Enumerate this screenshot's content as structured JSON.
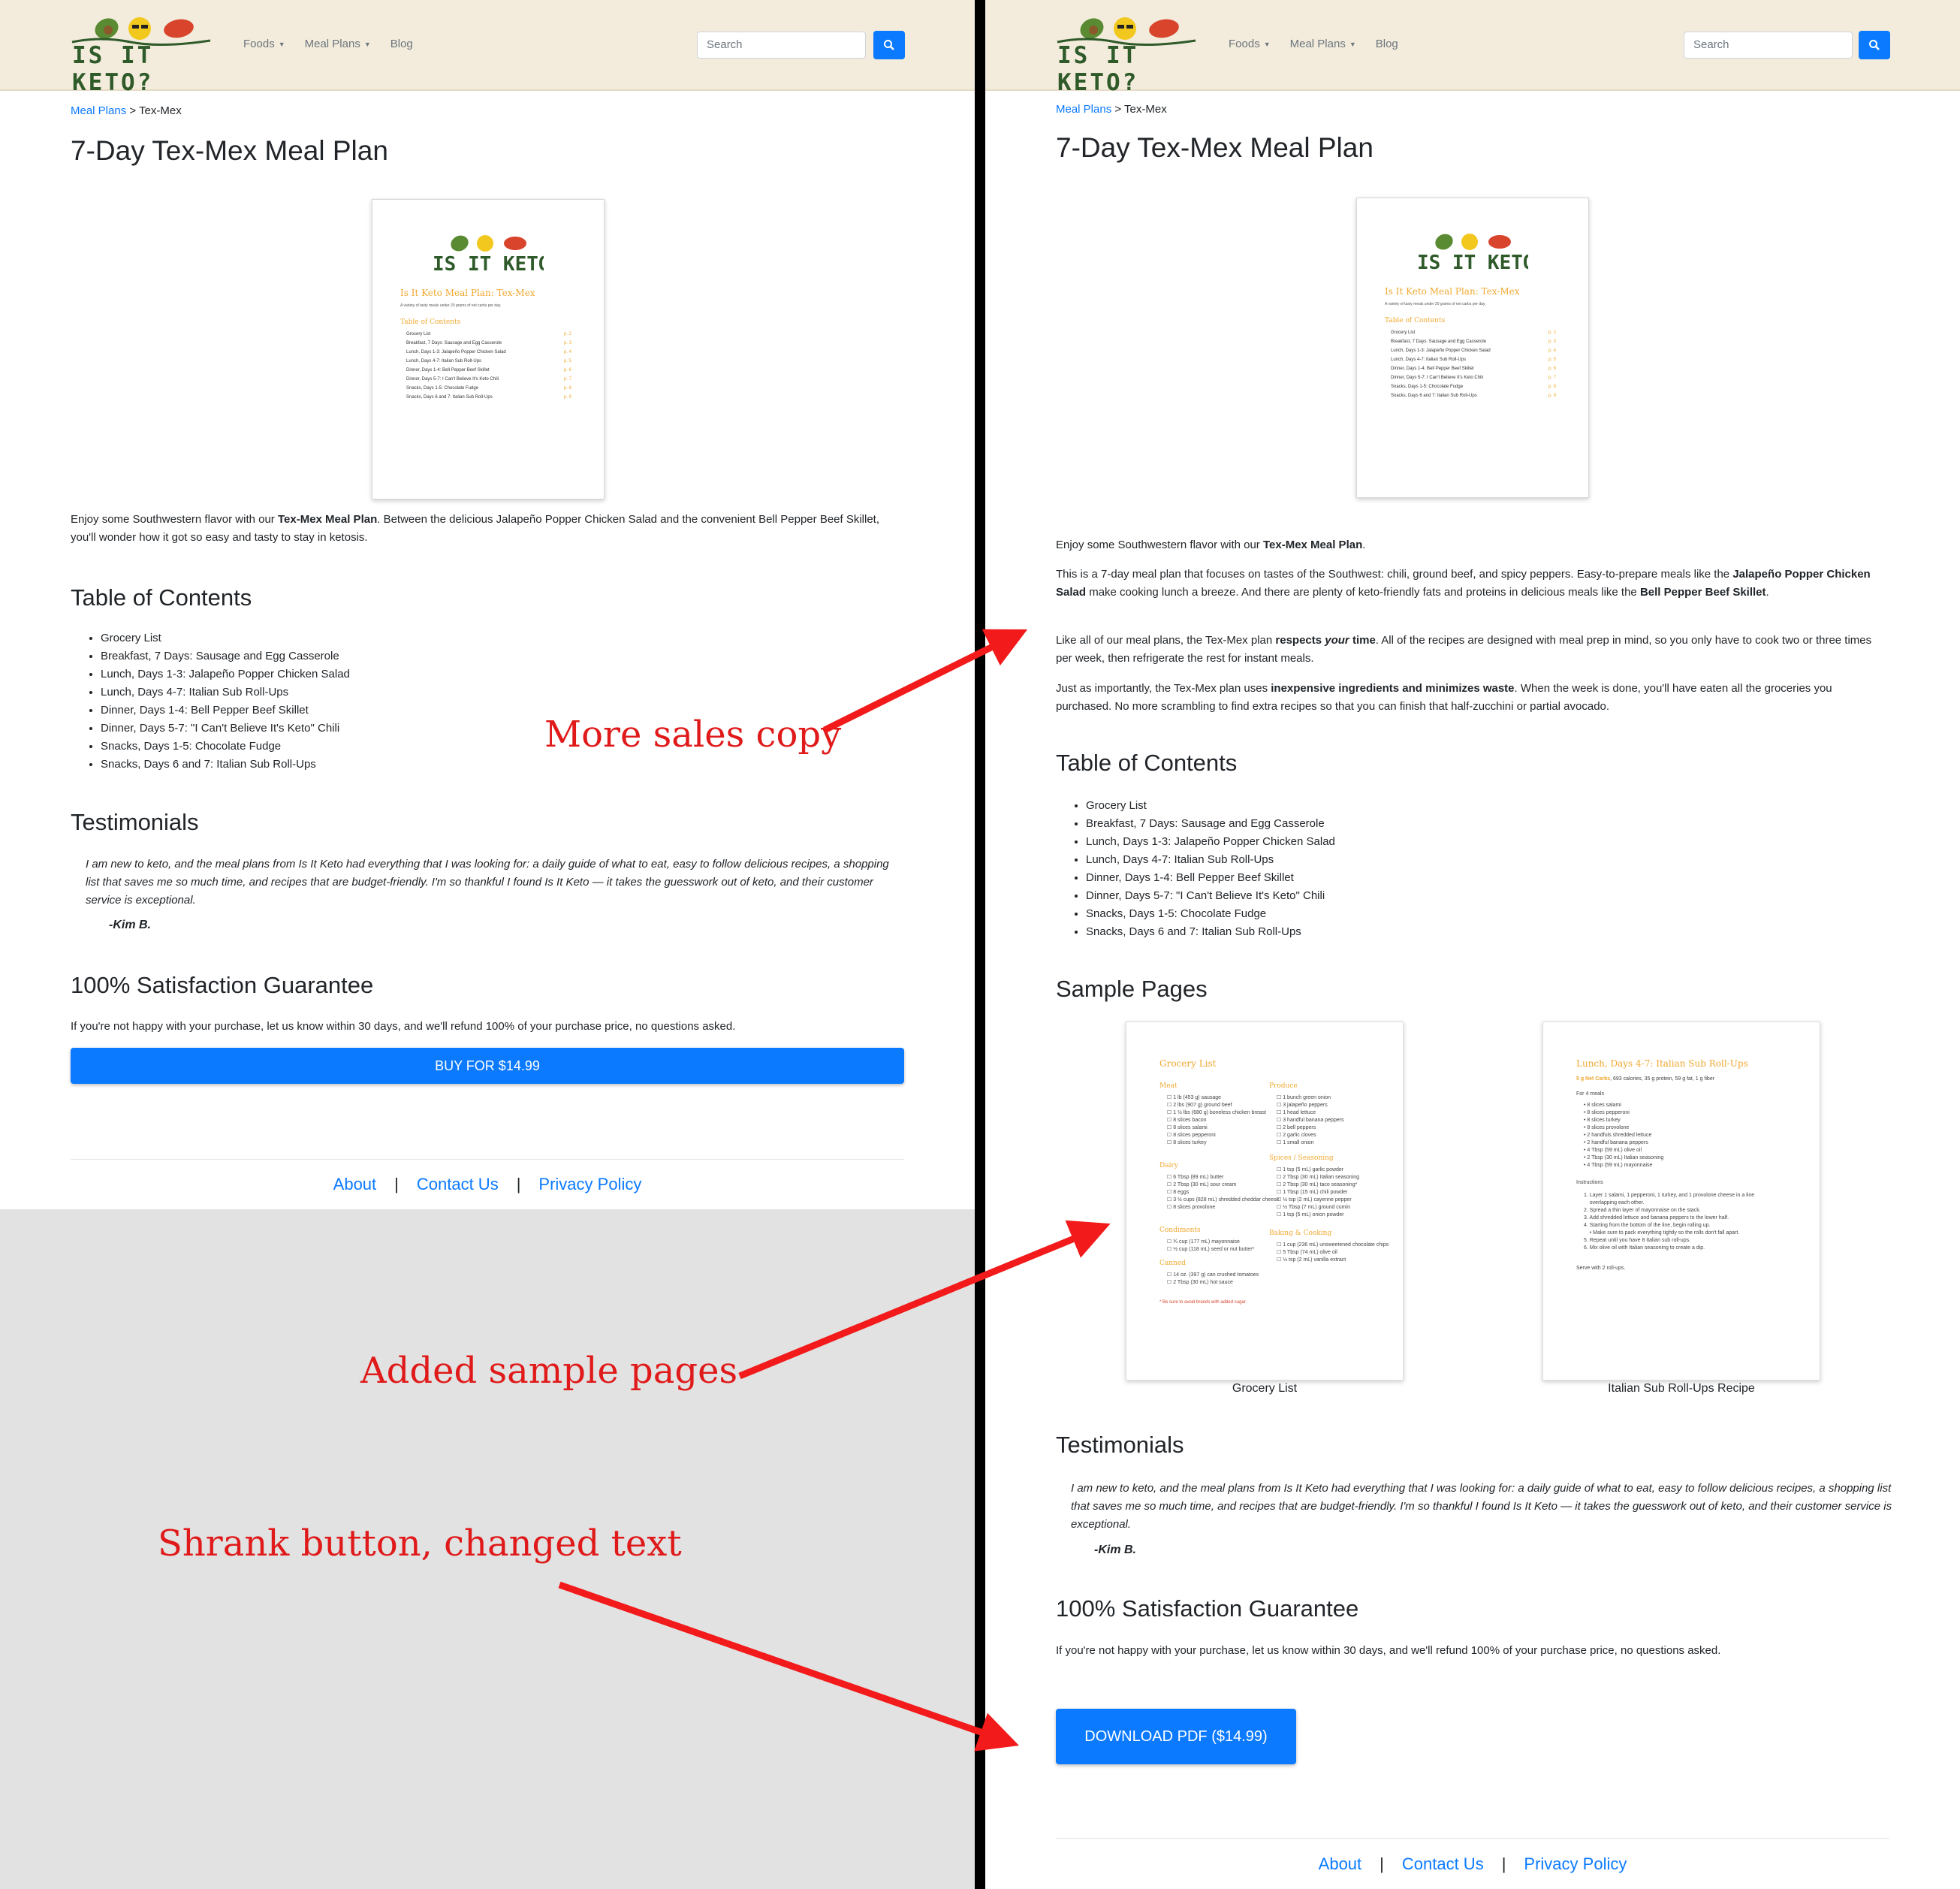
{
  "nav": {
    "logo_text": "IS IT KETO?",
    "items": [
      {
        "label": "Foods"
      },
      {
        "label": "Meal Plans"
      },
      {
        "label": "Blog"
      }
    ],
    "search_placeholder": "Search"
  },
  "breadcrumb": {
    "link": "Meal Plans",
    "separator": ">",
    "current": "Tex-Mex"
  },
  "page_title": "7-Day Tex-Mex Meal Plan",
  "cover": {
    "title": "Is It Keto Meal Plan: Tex-Mex",
    "subtitle": "A variety of tasty meals under 20 grams of net carbs per day.",
    "toc_heading": "Table of Contents",
    "toc": [
      {
        "label": "Grocery List",
        "page": "2"
      },
      {
        "label": "Breakfast, 7 Days: Sausage and Egg Casserole",
        "page": "3"
      },
      {
        "label": "Lunch, Days 1-3: Jalapeño Popper Chicken Salad",
        "page": "4"
      },
      {
        "label": "Lunch, Days 4-7: Italian Sub Roll-Ups",
        "page": "5"
      },
      {
        "label": "Dinner, Days 1-4: Bell Pepper Beef Skillet",
        "page": "6"
      },
      {
        "label": "Dinner, Days 5-7: I Can't Believe It's Keto Chili",
        "page": "7"
      },
      {
        "label": "Snacks, Days 1-5: Chocolate Fudge",
        "page": "8"
      },
      {
        "label": "Snacks, Days 6 and 7: Italian Sub Roll-Ups",
        "page": "9"
      }
    ]
  },
  "old": {
    "intro_pre": "Enjoy some Southwestern flavor with our ",
    "intro_bold": "Tex-Mex Meal Plan",
    "intro_post": ". Between the delicious Jalapeño Popper Chicken Salad and the convenient Bell Pepper Beef Skillet, you'll wonder how it got so easy and tasty to stay in ketosis.",
    "buy_label": "BUY FOR $14.99"
  },
  "new": {
    "p1_pre": "Enjoy some Southwestern flavor with our ",
    "p1_bold": "Tex-Mex Meal Plan",
    "p1_post": ".",
    "p2_a": "This is a 7-day meal plan that focuses on tastes of the Southwest: chili, ground beef, and spicy peppers. Easy-to-prepare meals like the ",
    "p2_b": "Jalapeño Popper Chicken Salad",
    "p2_c": " make cooking lunch a breeze. And there are plenty of keto-friendly fats and proteins in delicious meals like the ",
    "p2_d": "Bell Pepper Beef Skillet",
    "p2_e": ".",
    "p3_a": "Like all of our meal plans, the Tex-Mex plan ",
    "p3_b": "respects ",
    "p3_c": "your",
    "p3_d": " time",
    "p3_e": ". All of the recipes are designed with meal prep in mind, so you only have to cook two or three times per week, then refrigerate the rest for instant meals.",
    "p4_a": "Just as importantly, the Tex-Mex plan uses ",
    "p4_b": "inexpensive ingredients and minimizes waste",
    "p4_c": ". When the week is done, you'll have eaten all the groceries you purchased. No more scrambling to find extra recipes so that you can finish that half-zucchini or partial avocado.",
    "samples_heading": "Sample Pages",
    "samples": [
      {
        "caption": "Grocery List",
        "title": "Grocery List"
      },
      {
        "caption": "Italian Sub Roll-Ups Recipe",
        "title": "Lunch, Days 4-7: Italian Sub Roll-Ups"
      }
    ],
    "download_label": "DOWNLOAD PDF ($14.99)"
  },
  "toc_heading": "Table of Contents",
  "toc_old": [
    "Grocery List",
    "Breakfast, 7 Days: Sausage and Egg Casserole",
    "Lunch, Days 1-3: Jalapeño Popper Chicken Salad",
    "Lunch, Days 4-7: Italian Sub Roll-Ups",
    "Dinner, Days 1-4: Bell Pepper Beef Skillet",
    "Dinner, Days 5-7: \"I Can't Believe It's Keto\" Chili",
    "Snacks, Days 1-5: Chocolate Fudge",
    "Snacks, Days 6 and 7: Italian Sub Roll-Ups"
  ],
  "toc_new": [
    "Grocery List",
    "Breakfast, 7 Days: Sausage and Egg Casserole",
    "Lunch, Days 1-3: Jalapeño Popper Chicken Salad",
    "Lunch, Days 4-7: Italian Sub Roll-Ups",
    "Dinner, Days 1-4: Bell Pepper Beef Skillet",
    "Dinner, Days 5-7: \"I Can't Believe It's Keto\" Chili",
    "Snacks, Days 1-5: Chocolate Fudge",
    "Snacks, Days 6 and 7: Italian Sub Roll-Ups"
  ],
  "testimonials": {
    "heading": "Testimonials",
    "quote": "I am new to keto, and the meal plans from Is It Keto had everything that I was looking for: a daily guide of what to eat, easy to follow delicious recipes, a shopping list that saves me so much time, and recipes that are budget-friendly. I'm so thankful I found Is It Keto — it takes the guesswork out of keto, and their customer service is exceptional.",
    "author": "-Kim B."
  },
  "guarantee": {
    "heading": "100% Satisfaction Guarantee",
    "text": "If you're not happy with your purchase, let us know within 30 days, and we'll refund 100% of your purchase price, no questions asked."
  },
  "footer": {
    "links": [
      "About",
      "Contact Us",
      "Privacy Policy"
    ],
    "separator": "|"
  },
  "annotations": {
    "sales": "More sales copy",
    "samples": "Added sample pages",
    "button": "Shrank button, changed text"
  },
  "colors": {
    "accent": "#0b7aff",
    "nav_bg": "#f3ecdc",
    "annotation": "#e01a1a",
    "pdf_heading": "#f0a830"
  }
}
